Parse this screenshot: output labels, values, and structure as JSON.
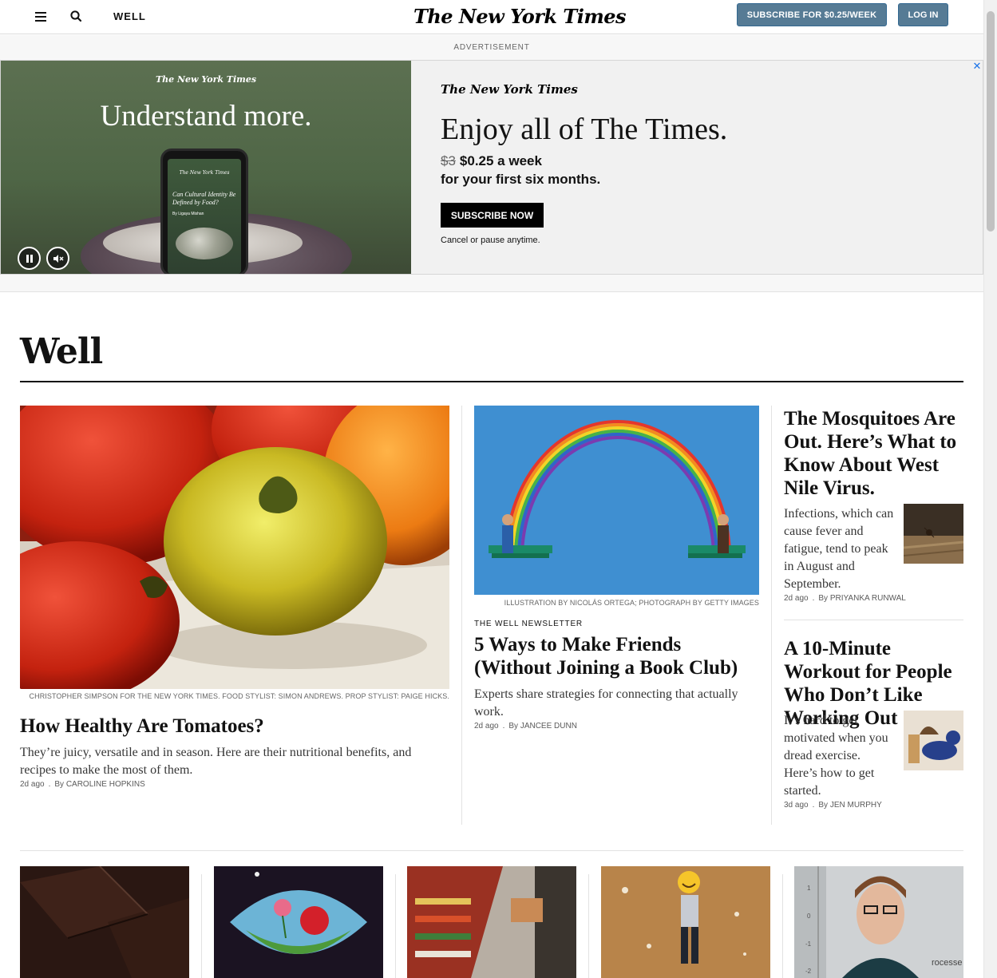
{
  "header": {
    "section": "WELL",
    "masthead": "The New York Times",
    "subscribe_label": "SUBSCRIBE FOR $0.25/WEEK",
    "login_label": "LOG IN"
  },
  "ad": {
    "label": "ADVERTISEMENT",
    "visual_logo": "The New York Times",
    "visual_tagline": "Understand more.",
    "phone_logo": "The New York Times",
    "phone_headline": "Can Cultural Identity Be Defined by Food?",
    "phone_byline": "By Ligaya Mishan",
    "copy_logo": "The New York Times",
    "headline": "Enjoy all of The Times.",
    "old_price": "$3",
    "new_price": "$0.25 a week",
    "subline": "for your first six months.",
    "cta": "SUBSCRIBE NOW",
    "note": "Cancel or pause anytime.",
    "close_glyph": "✕"
  },
  "section": {
    "title": "Well"
  },
  "lead": {
    "credit": "CHRISTOPHER SIMPSON FOR THE NEW YORK TIMES. FOOD STYLIST: SIMON ANDREWS. PROP STYLIST: PAIGE HICKS.",
    "title": "How Healthy Are Tomatoes?",
    "summary": "They’re juicy, versatile and in season. Here are their nutritional benefits, and recipes to make the most of them.",
    "time": "2d ago",
    "byline": "By CAROLINE HOPKINS"
  },
  "middle": {
    "credit": "ILLUSTRATION BY NICOLÁS ORTEGA; PHOTOGRAPH BY GETTY IMAGES",
    "kicker": "THE WELL NEWSLETTER",
    "title": "5 Ways to Make Friends (Without Joining a Book Club)",
    "summary": "Experts share strategies for connecting that actually work.",
    "time": "2d ago",
    "byline": "By JANCEE DUNN"
  },
  "right": [
    {
      "title": "The Mosquitoes Are Out. Here’s What to Know About West Nile Virus.",
      "summary": "Infections, which can cause fever and fatigue, tend to peak in August and September.",
      "time": "2d ago",
      "byline": "By PRIYANKA RUNWAL"
    },
    {
      "title": "A 10-Minute Workout for People Who Don’t Like Working Out",
      "summary": "It’s hard to get motivated when you dread exercise. Here’s how to get started.",
      "time": "3d ago",
      "byline": "By JEN MURPHY"
    }
  ],
  "bottom_fragment_text": "rocesse",
  "bottom_axis_ticks": [
    "1",
    "0",
    "-1",
    "-2"
  ],
  "colors": {
    "subscribe_bg": "#567b95",
    "ad_bg": "#f1f1f1",
    "text": "#121212",
    "meta": "#5a5a5a"
  }
}
